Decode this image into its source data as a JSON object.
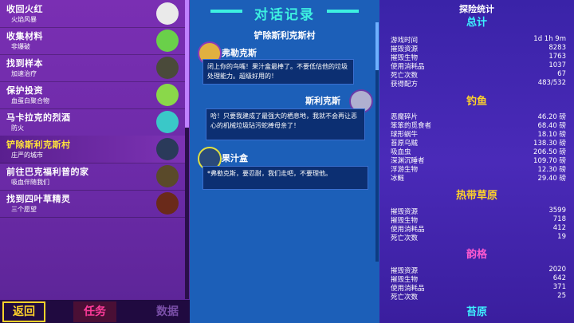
{
  "quests": [
    {
      "title": "收回火红",
      "subtitle": "火焰风暴"
    },
    {
      "title": "收集材料",
      "subtitle": "非爆破"
    },
    {
      "title": "找到样本",
      "subtitle": "加速治疗"
    },
    {
      "title": "保护投资",
      "subtitle": "血蛋白聚合物"
    },
    {
      "title": "马卡拉克的烈酒",
      "subtitle": "防火"
    },
    {
      "title": "铲除斯利克斯村",
      "subtitle": "庄严的城市"
    },
    {
      "title": "前往巴克福利普的家",
      "subtitle": "吸血伴随我们"
    },
    {
      "title": "找到四叶草精灵",
      "subtitle": "三个愿望"
    }
  ],
  "tabs": {
    "back": "返回",
    "task": "任务",
    "data": "数据"
  },
  "dialog": {
    "title": "对话记录",
    "location": "铲除斯利克斯村",
    "entries": [
      {
        "speaker": "弗勒克斯",
        "text": "闭上你的鸟嘴！果汁盒最棒了。不要低估他的垃圾处理能力。超级好用的！"
      },
      {
        "speaker": "斯利克斯",
        "text": "哈！只要我建成了最强大的栖息地，我就不会再让恶心的机械垃圾玷污蛇棒母亲了！"
      },
      {
        "speaker": "果汁盒",
        "text": "*弗勒克斯，要忍耐，我们走吧，不要理他。"
      }
    ]
  },
  "stats": {
    "title": "探险统计",
    "sections": [
      {
        "name": "总计",
        "color": "#3df0ff",
        "rows": [
          {
            "k": "游戏时间",
            "v": "1d 1h 9m"
          },
          {
            "k": "摧毁资源",
            "v": "8283"
          },
          {
            "k": "摧毁生物",
            "v": "1763"
          },
          {
            "k": "使用消耗品",
            "v": "1037"
          },
          {
            "k": "死亡次数",
            "v": "67"
          },
          {
            "k": "获得配方",
            "v": "483/532"
          }
        ]
      },
      {
        "name": "钓鱼",
        "color": "#ffd22a",
        "rows": [
          {
            "k": "恶魔碎片",
            "v": "46.20 磅"
          },
          {
            "k": "笨笨的觅食者",
            "v": "68.40 磅"
          },
          {
            "k": "球形蜗牛",
            "v": "18.10 磅"
          },
          {
            "k": "苔原乌贼",
            "v": "138.30 磅"
          },
          {
            "k": "吸血虫",
            "v": "206.50 磅"
          },
          {
            "k": "深渊沉睡者",
            "v": "109.70 磅"
          },
          {
            "k": "浮游生物",
            "v": "12.30 磅"
          },
          {
            "k": "冰鳐",
            "v": "29.40 磅"
          }
        ]
      },
      {
        "name": "热带草原",
        "color": "#ffd22a",
        "rows": [
          {
            "k": "摧毁资源",
            "v": "3599"
          },
          {
            "k": "摧毁生物",
            "v": "718"
          },
          {
            "k": "使用消耗品",
            "v": "412"
          },
          {
            "k": "死亡次数",
            "v": "19"
          }
        ]
      },
      {
        "name": "韵格",
        "color": "#ff5ad0",
        "rows": [
          {
            "k": "摧毁资源",
            "v": "2020"
          },
          {
            "k": "摧毁生物",
            "v": "642"
          },
          {
            "k": "使用消耗品",
            "v": "371"
          },
          {
            "k": "死亡次数",
            "v": "25"
          }
        ]
      },
      {
        "name": "苔原",
        "color": "#3df0ff",
        "rows": []
      }
    ]
  },
  "colors": {
    "left_bg": "#6a2aa6",
    "mid_bg": "#1c5fb8",
    "right_bg": "#4a2ab8",
    "accent_yellow": "#ffe23a",
    "accent_cyan": "#3df0e0"
  }
}
